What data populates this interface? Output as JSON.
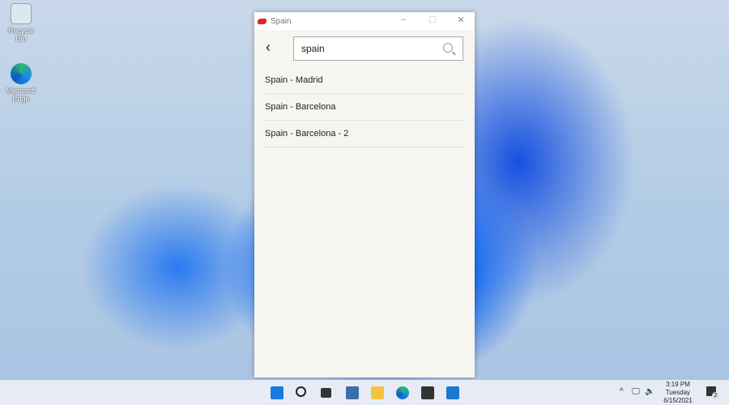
{
  "desktop": {
    "icons": [
      {
        "label": "Recycle Bin"
      },
      {
        "label": "Microsoft Edge"
      }
    ]
  },
  "window": {
    "title": "Spain",
    "minimize": "–",
    "maximize": "☐",
    "close": "✕",
    "search": {
      "value": "spain"
    },
    "results": [
      "Spain - Madrid",
      "Spain - Barcelona",
      "Spain - Barcelona - 2"
    ]
  },
  "taskbar": {
    "time": "3:19 PM",
    "day": "Tuesday",
    "date": "6/15/2021",
    "notifications": "2",
    "chevron": "^"
  }
}
